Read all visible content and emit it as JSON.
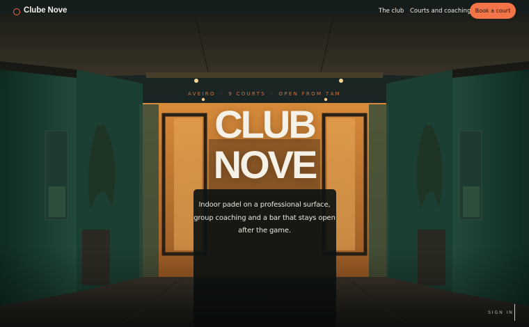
{
  "brand": {
    "name": "Clube Nove",
    "accent": "#f06a3d"
  },
  "nav": {
    "links": [
      "The club",
      "Courts and coaching"
    ],
    "cta_label": "Book a court"
  },
  "hero": {
    "eyebrow": [
      "AVEIRO",
      "9 COURTS",
      "OPEN FROM 7AM"
    ],
    "title_line1": "CLUB",
    "title_line2": "NOVE",
    "lede": "Indoor padel on a professional surface, group coaching and a bar that stays open after the game."
  },
  "footer": {
    "signin_label": "SIGN IN"
  },
  "colors": {
    "cta": "#f27448",
    "eyebrow": "#d4743f",
    "title": "#f6f1e7"
  }
}
